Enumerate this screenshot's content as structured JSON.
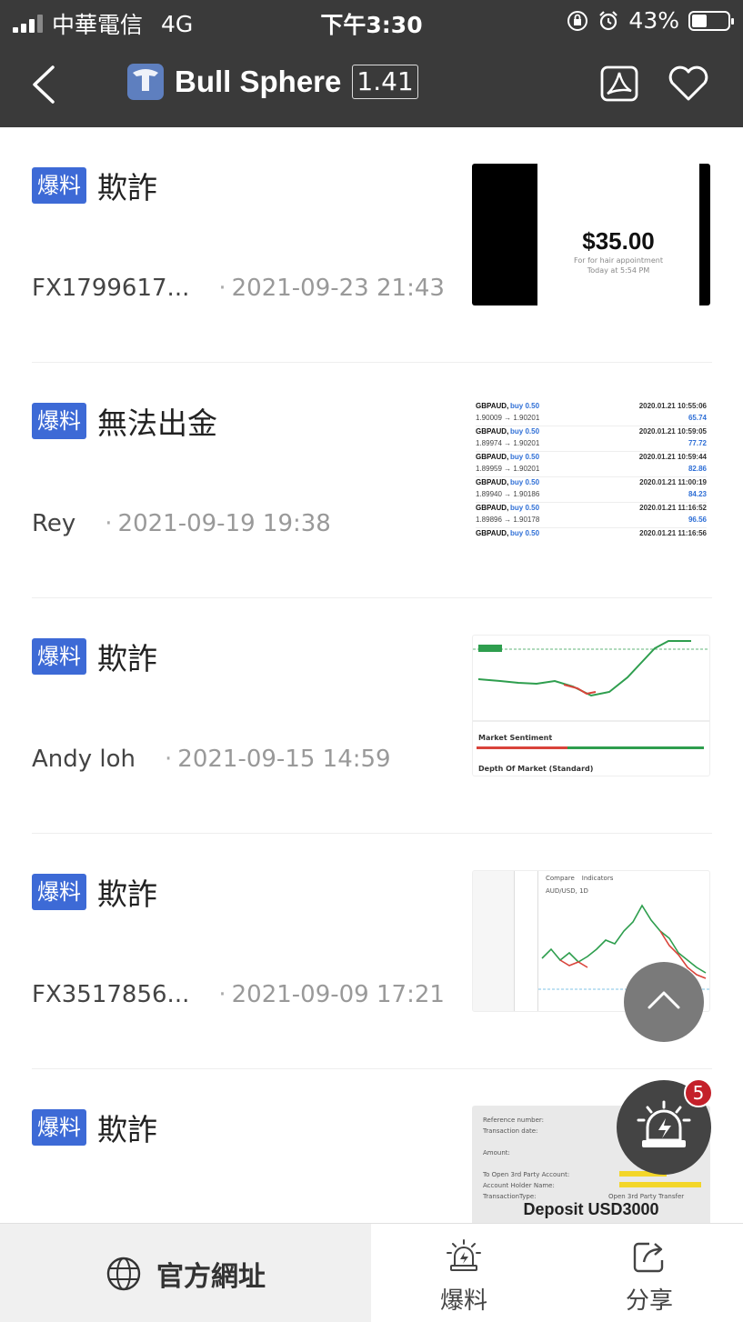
{
  "status_bar": {
    "carrier": "中華電信",
    "network": "4G",
    "time": "下午3:30",
    "battery": "43%",
    "battery_level": 0.43
  },
  "header": {
    "title": "Bull Sphere",
    "score": "1.41"
  },
  "items": [
    {
      "tag": "爆料",
      "title": "欺詐",
      "author": "FX1799617...",
      "date": "2021-09-23 21:43",
      "thumb": {
        "amount": "$35.00",
        "caption1": "For for hair appointment",
        "caption2": "Today at 5:54 PM"
      }
    },
    {
      "tag": "爆料",
      "title": "無法出金",
      "author": "Rey",
      "date": "2021-09-19 19:38",
      "thumb": {
        "trades": [
          {
            "pair": "GBPAUD,",
            "side": "buy 0.50",
            "time": "2020.01.21 10:55:06",
            "prices": "1.90009 → 1.90201",
            "profit": "65.74"
          },
          {
            "pair": "GBPAUD,",
            "side": "buy 0.50",
            "time": "2020.01.21 10:59:05",
            "prices": "1.89974 → 1.90201",
            "profit": "77.72"
          },
          {
            "pair": "GBPAUD,",
            "side": "buy 0.50",
            "time": "2020.01.21 10:59:44",
            "prices": "1.89959 → 1.90201",
            "profit": "82.86"
          },
          {
            "pair": "GBPAUD,",
            "side": "buy 0.50",
            "time": "2020.01.21 11:00:19",
            "prices": "1.89940 → 1.90186",
            "profit": "84.23"
          },
          {
            "pair": "GBPAUD,",
            "side": "buy 0.50",
            "time": "2020.01.21 11:16:52",
            "prices": "1.89896 → 1.90178",
            "profit": "96.56"
          },
          {
            "pair": "GBPAUD,",
            "side": "buy 0.50",
            "time": "2020.01.21 11:16:56",
            "prices": "",
            "profit": ""
          }
        ]
      }
    },
    {
      "tag": "爆料",
      "title": "欺詐",
      "author": "Andy loh",
      "date": "2021-09-15 14:59",
      "thumb": {
        "label1": "Market Sentiment",
        "label2": "Depth Of Market (Standard)"
      }
    },
    {
      "tag": "爆料",
      "title": "欺詐",
      "author": "FX3517856...",
      "date": "2021-09-09 17:21",
      "thumb": {
        "symbol": "AUD/USD, 1D",
        "compare": "Compare",
        "indicators": "Indicators"
      }
    },
    {
      "tag": "爆料",
      "title": "欺詐",
      "author": "",
      "date": "",
      "thumb": {
        "caption": "Deposit USD3000",
        "l1": "Reference number:",
        "l2": "Transaction date:",
        "l3": "Amount:",
        "l4": "To Open 3rd Party Account:",
        "l5": "Account Holder Name:",
        "l6": "TransactionType:",
        "l7": "Open 3rd Party Transfer"
      }
    }
  ],
  "fab": {
    "badge": "5"
  },
  "bottom_bar": {
    "official_label": "官方網址",
    "report_label": "爆料",
    "share_label": "分享"
  },
  "colors": {
    "accent": "#3d6ad6",
    "header_bg": "#3a3a3a",
    "badge_red": "#c4202a"
  }
}
